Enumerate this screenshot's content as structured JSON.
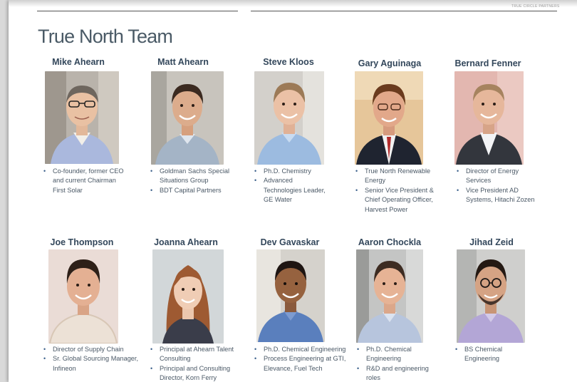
{
  "header": {
    "tag": "TRUE CIRCLE PARTNERS"
  },
  "title": "True North Team",
  "colors": {
    "title": "#4a5a66",
    "name": "#33475b",
    "bullet_text": "#4a5866",
    "bullet_marker": "#3a5f8a"
  },
  "members": [
    {
      "name": "Mike Ahearn",
      "bullets": [
        "Co-founder, former CEO and current Chairman First Solar"
      ]
    },
    {
      "name": "Matt Ahearn",
      "bullets": [
        "Goldman Sachs Special Situations Group",
        "BDT Capital Partners"
      ]
    },
    {
      "name": "Steve Kloos",
      "bullets": [
        "Ph.D. Chemistry",
        "Advanced Technologies Leader, GE Water"
      ]
    },
    {
      "name": "Gary Aguinaga",
      "bullets": [
        "True North Renewable Energy",
        "Senior Vice President & Chief Operating Officer, Harvest Power"
      ]
    },
    {
      "name": "Bernard Fenner",
      "bullets": [
        "Director of Energy Services",
        "Vice President AD Systems, Hitachi Zozen"
      ]
    },
    {
      "name": "Joe Thompson",
      "bullets": [
        "Director of Supply Chain",
        "Sr. Global Sourcing Manager, Infineon"
      ]
    },
    {
      "name": "Joanna Ahearn",
      "bullets": [
        "Principal at Ahearn Talent Consulting",
        "Principal and Consulting Director, Korn Ferry"
      ]
    },
    {
      "name": "Dev Gavaskar",
      "bullets": [
        "Ph.D. Chemical Engineering",
        "Process Engineering at GTI, Elevance, Fuel Tech"
      ]
    },
    {
      "name": "Aaron Chockla",
      "bullets": [
        "Ph.D. Chemical Engineering",
        "R&D and engineering roles"
      ]
    },
    {
      "name": "Jihad Zeid",
      "bullets": [
        "BS Chemical Engineering"
      ]
    }
  ]
}
